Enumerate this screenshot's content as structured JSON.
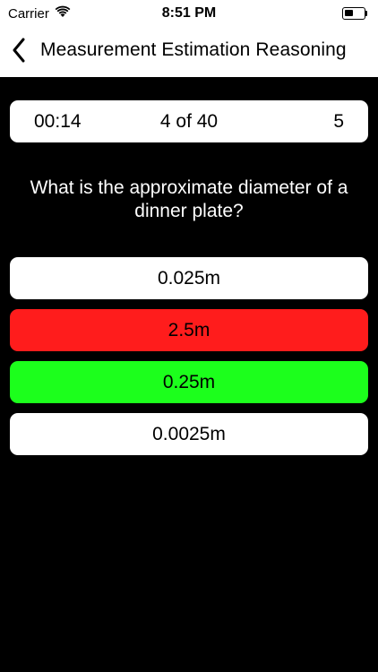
{
  "status_bar": {
    "carrier": "Carrier",
    "time": "8:51 PM",
    "wifi_icon": "wifi-icon",
    "battery_icon": "battery-icon",
    "battery_level": 0.45
  },
  "nav": {
    "back_icon": "chevron-left-icon",
    "title": "Measurement Estimation Reasoning"
  },
  "quiz": {
    "timer": "00:14",
    "progress": "4 of 40",
    "score": "5",
    "question": "What is the approximate diameter of a dinner plate?",
    "answers": [
      {
        "label": "0.025m",
        "state": "neutral",
        "color": "#ffffff"
      },
      {
        "label": "2.5m",
        "state": "wrong",
        "color": "#ff1c1c"
      },
      {
        "label": "0.25m",
        "state": "correct",
        "color": "#1cff1c"
      },
      {
        "label": "0.0025m",
        "state": "neutral",
        "color": "#ffffff"
      }
    ]
  },
  "colors": {
    "background": "#000000",
    "card": "#ffffff",
    "wrong": "#ff1c1c",
    "correct": "#1cff1c"
  }
}
